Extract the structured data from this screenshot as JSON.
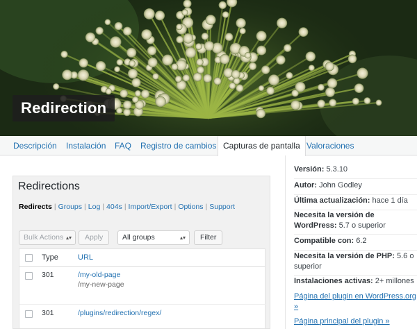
{
  "banner": {
    "title": "Redirection"
  },
  "tabs": [
    {
      "label": "Descripción"
    },
    {
      "label": "Instalación"
    },
    {
      "label": "FAQ"
    },
    {
      "label": "Registro de cambios"
    },
    {
      "label": "Capturas de pantalla",
      "active": true
    },
    {
      "label": "Valoraciones"
    }
  ],
  "screenshot": {
    "title": "Redirections",
    "subnav": {
      "current": "Redirects",
      "links": [
        "Groups",
        "Log",
        "404s",
        "Import/Export",
        "Options",
        "Support"
      ],
      "separator": "|"
    },
    "bulk_actions": "Bulk Actions",
    "apply": "Apply",
    "group_select": "All groups",
    "filter": "Filter",
    "columns": {
      "type": "Type",
      "url": "URL"
    },
    "rows": [
      {
        "code": "301",
        "url": "/my-old-page",
        "target": "/my-new-page"
      },
      {
        "code": "301",
        "url": "/plugins/redirection/regex/",
        "target": ""
      }
    ]
  },
  "meta": {
    "version": {
      "label": "Versión:",
      "value": "5.3.10"
    },
    "author": {
      "label": "Autor:",
      "value": "John Godley"
    },
    "updated": {
      "label": "Última actualización:",
      "value": "hace 1 día"
    },
    "requires_wp": {
      "label": "Necesita la versión de WordPress:",
      "value": "5.7 o superior"
    },
    "compatible": {
      "label": "Compatible con:",
      "value": "6.2"
    },
    "requires_php": {
      "label": "Necesita la versión de PHP:",
      "value": "5.6 o superior"
    },
    "installs": {
      "label": "Instalaciones activas:",
      "value": "2+ millones"
    },
    "link_plugin_page": "Página del plugin en WordPress.org »",
    "link_home": "Página principal del plugin »"
  },
  "colors": {
    "link": "#2271b1",
    "banner_label_bg": "#1e1e1e"
  },
  "icons": {
    "select_caret": "caret-updown-icon"
  }
}
